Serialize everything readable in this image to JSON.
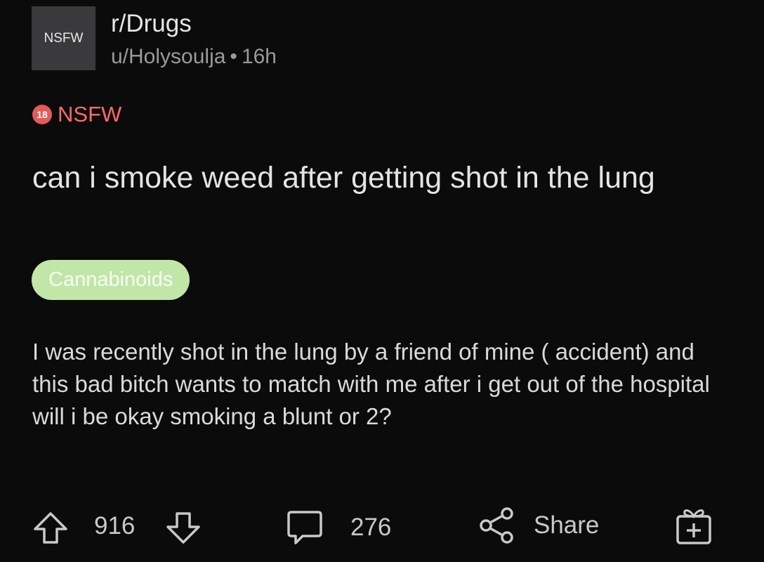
{
  "post": {
    "subreddit": "r/Drugs",
    "subreddit_avatar_text": "NSFW",
    "author": "u/Holysoulja",
    "separator": "•",
    "age": "16h",
    "nsfw_badge_number": "18",
    "nsfw_label": "NSFW",
    "title": "can i smoke weed after getting shot in the lung",
    "flair": "Cannabinoids",
    "body": "I was recently shot in the lung by a friend of mine ( accident) and this bad bitch wants to match with me after i get out of the hospital will i be okay smoking a blunt or 2?"
  },
  "actions": {
    "upvote_count": "916",
    "comment_count": "276",
    "share_label": "Share"
  },
  "colors": {
    "background": "#0b0b0c",
    "nsfw_red": "#ff6b67",
    "flair_green": "#c2e6a8",
    "icon_gray": "#c9c9c9"
  },
  "icons": [
    "upvote-icon",
    "downvote-icon",
    "comment-icon",
    "share-icon",
    "award-icon"
  ]
}
